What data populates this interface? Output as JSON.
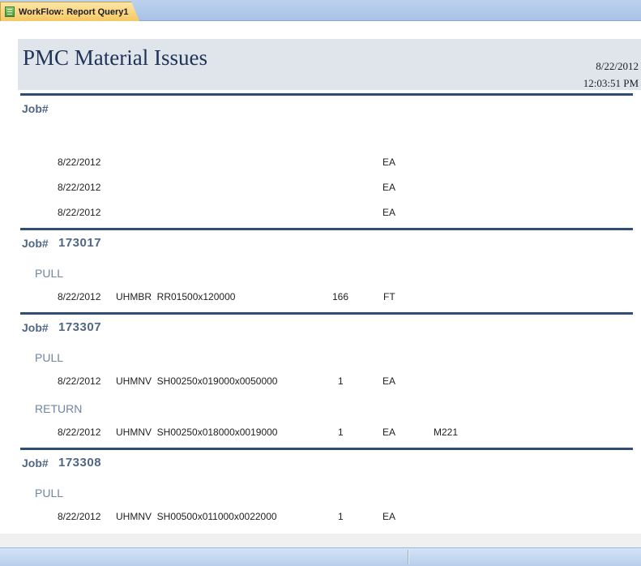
{
  "window": {
    "tab_title": "WorkFlow: Report Query1",
    "tab_icon": "report-icon"
  },
  "report": {
    "title": "PMC Material Issues",
    "date": "8/22/2012",
    "time": "12:03:51 PM",
    "job_label": "Job#",
    "groups": [
      {
        "job": "",
        "sections": [
          {
            "type": "",
            "rows": [
              {
                "date": "8/22/2012",
                "part": "",
                "qty": "",
                "uom": "EA",
                "loc": ""
              },
              {
                "date": "8/22/2012",
                "part": "",
                "qty": "",
                "uom": "EA",
                "loc": ""
              },
              {
                "date": "8/22/2012",
                "part": "",
                "qty": "",
                "uom": "EA",
                "loc": ""
              }
            ]
          }
        ]
      },
      {
        "job": "173017",
        "sections": [
          {
            "type": "PULL",
            "rows": [
              {
                "date": "8/22/2012",
                "part": "UHMBR  RR01500x120000",
                "qty": "166",
                "uom": "FT",
                "loc": ""
              }
            ]
          }
        ]
      },
      {
        "job": "173307",
        "sections": [
          {
            "type": "PULL",
            "rows": [
              {
                "date": "8/22/2012",
                "part": "UHMNV  SH00250x019000x0050000",
                "qty": "1",
                "uom": "EA",
                "loc": ""
              }
            ]
          },
          {
            "type": "RETURN",
            "rows": [
              {
                "date": "8/22/2012",
                "part": "UHMNV  SH00250x018000x0019000",
                "qty": "1",
                "uom": "EA",
                "loc": "M221"
              }
            ]
          }
        ]
      },
      {
        "job": "173308",
        "sections": [
          {
            "type": "PULL",
            "rows": [
              {
                "date": "8/22/2012",
                "part": "UHMNV  SH00500x011000x0022000",
                "qty": "1",
                "uom": "EA",
                "loc": ""
              }
            ]
          }
        ]
      }
    ]
  }
}
